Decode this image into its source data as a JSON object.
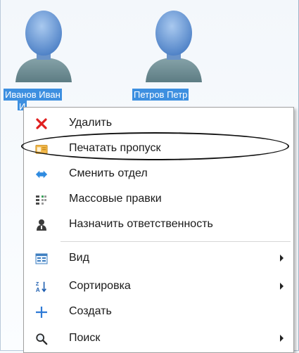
{
  "users": [
    {
      "name": "Иванов Иван",
      "name_cut": "И"
    },
    {
      "name": "Петров Петр"
    }
  ],
  "menu": {
    "items": [
      {
        "label": "Удалить",
        "icon": "delete-icon"
      },
      {
        "label": "Печатать пропуск",
        "icon": "print-pass-icon"
      },
      {
        "label": "Сменить отдел",
        "icon": "change-department-icon"
      },
      {
        "label": "Массовые правки",
        "icon": "bulk-edit-icon"
      },
      {
        "label": "Назначить ответственность",
        "icon": "assign-responsibility-icon"
      },
      {
        "label": "Вид",
        "icon": "view-icon",
        "submenu": true
      },
      {
        "label": "Сортировка",
        "icon": "sort-icon",
        "submenu": true
      },
      {
        "label": "Создать",
        "icon": "create-icon"
      },
      {
        "label": "Поиск",
        "icon": "search-icon",
        "submenu": true
      }
    ]
  },
  "colors": {
    "selection": "#3d8fe0",
    "delete": "#e01f1f",
    "avatar": "#6f9fd8"
  }
}
